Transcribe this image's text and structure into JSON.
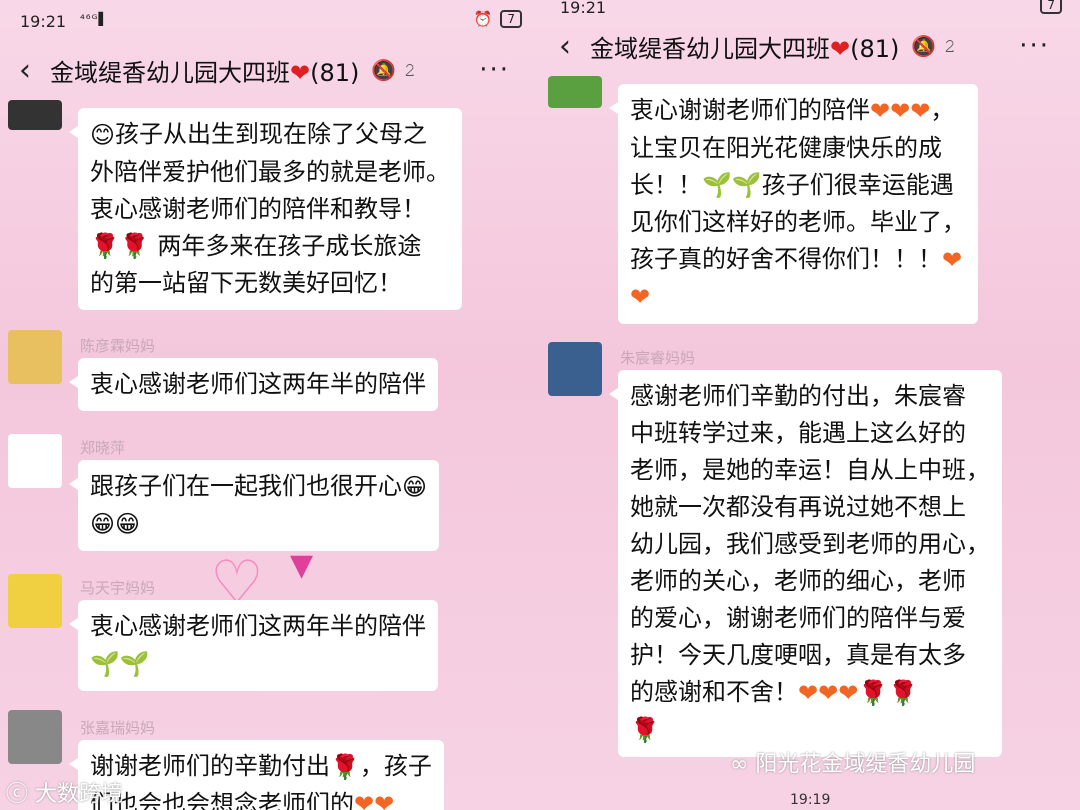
{
  "status": {
    "left_time": "19:21",
    "left_signal": "⁴⁶ᴳ▌",
    "battery": "7",
    "right_time": "19:21"
  },
  "header": {
    "title": "金域缇香幼儿园大四班",
    "heart": "❤",
    "count": "(81)"
  },
  "left_chat": [
    {
      "name": "",
      "text": [
        "孩子从出生到现在除了父母之",
        "外陪伴爱护他们最多的就是老师。",
        "衷心感谢老师们的陪伴和教导！",
        "两年多来在孩子成长旅途",
        "的第一站留下无数美好回忆！"
      ]
    },
    {
      "name": "陈彦霖妈妈",
      "text": [
        "衷心感谢老师们这两年半的陪伴"
      ]
    },
    {
      "name": "郑晓萍",
      "text": [
        "跟孩子们在一起我们也很开心"
      ]
    },
    {
      "name": "马天宇妈妈",
      "text": [
        "衷心感谢老师们这两年半的陪伴"
      ]
    },
    {
      "name": "张嘉瑞妈妈",
      "text": [
        "谢谢老师们的辛勤付出",
        "，孩子",
        "们也会也会想念老师们的"
      ]
    }
  ],
  "right_chat": [
    {
      "name": "",
      "text": [
        "衷心谢谢老师们的陪伴",
        "让宝贝在阳光花健康快乐的成",
        "长！！",
        "孩子们很幸运能遇",
        "见你们这样好的老师。毕业了，",
        "孩子真的好舍不得你们！！！"
      ]
    },
    {
      "name": "朱宸睿妈妈",
      "text": [
        "感谢老师们辛勤的付出，朱宸睿",
        "中班转学过来，能遇上这么好的",
        "老师，是她的幸运！自从上中班，",
        "她就一次都没有再说过她不想上",
        "幼儿园，我们感受到老师的用心，",
        "老师的关心，老师的细心，老师",
        "的爱心，谢谢老师们的陪伴与爱",
        "护！今天几度哽咽，真是有太多",
        "的感谢和不舍！"
      ]
    }
  ],
  "footer": {
    "timestamp": "19:19",
    "watermark_right": "阳光花金域缇香幼儿园",
    "watermark_left": "大数跨境"
  },
  "colors": {
    "bg": "#f4c7dc",
    "bubble": "#ffffff",
    "heart": "#e02020",
    "orange_heart": "#f26522",
    "rose": "#d01030"
  }
}
